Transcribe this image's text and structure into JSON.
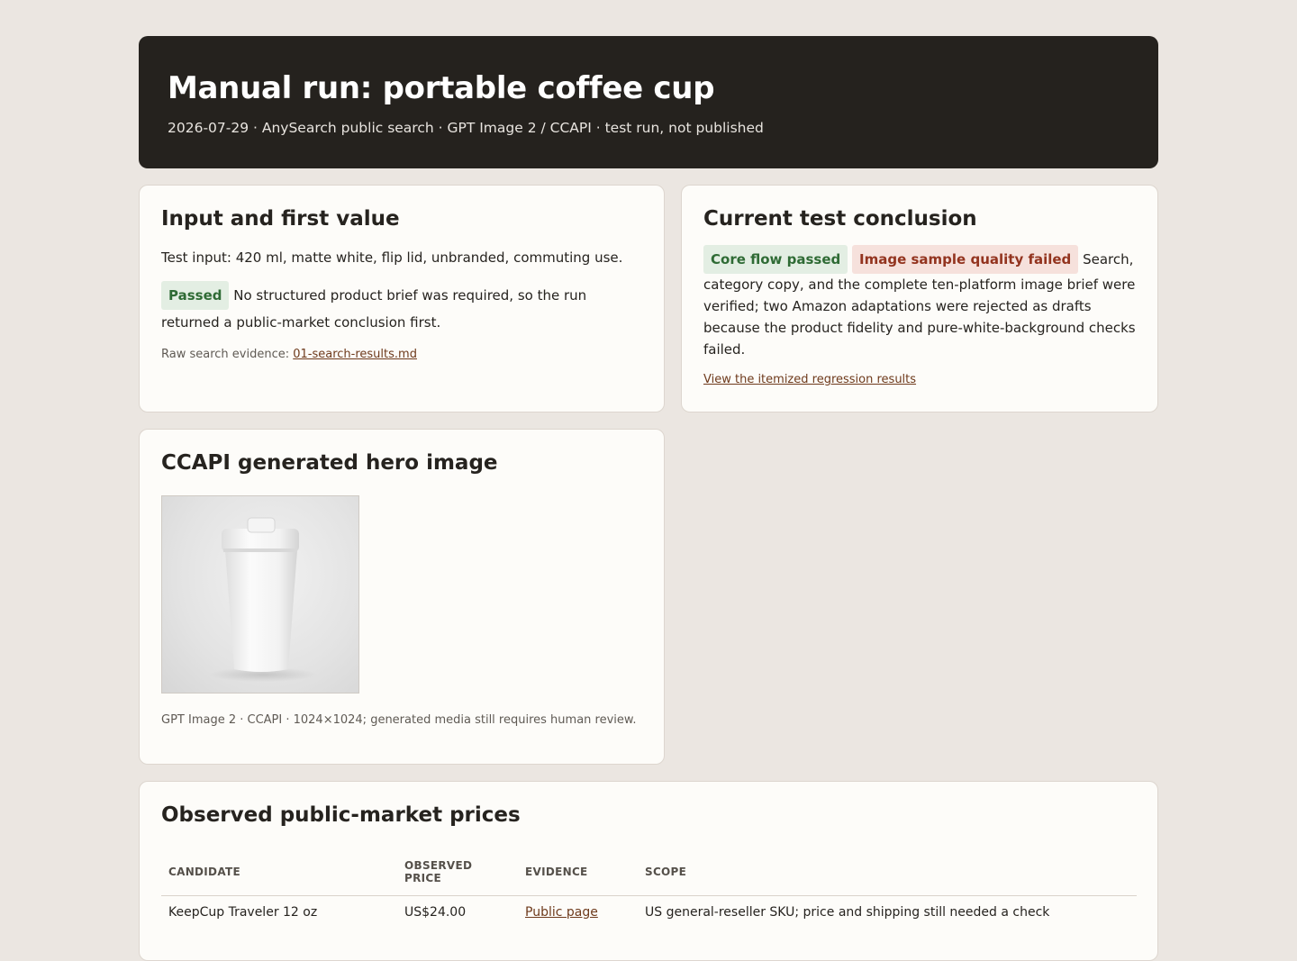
{
  "header": {
    "title": "Manual run: portable coffee cup",
    "meta": "2026-07-29 · AnySearch public search · GPT Image 2 / CCAPI · test run, not published"
  },
  "input_card": {
    "title": "Input and first value",
    "test_input": "Test input: 420 ml, matte white, flip lid, unbranded, commuting use.",
    "badge": "Passed",
    "result_text": "No structured product brief was required, so the run returned a public-market conclusion first.",
    "evidence_label": "Raw search evidence: ",
    "evidence_link": "01-search-results.md"
  },
  "conclusion_card": {
    "title": "Current test conclusion",
    "badge_pass": "Core flow passed",
    "badge_fail": "Image sample quality failed",
    "text": "Search, category copy, and the complete ten-platform image brief were verified; two Amazon adaptations were rejected as drafts because the product fidelity and pure-white-background checks failed.",
    "link": "View the itemized regression results"
  },
  "hero_card": {
    "title": "CCAPI generated hero image",
    "caption": "GPT Image 2 · CCAPI · 1024×1024; generated media still requires human review."
  },
  "prices_card": {
    "title": "Observed public-market prices",
    "columns": [
      "CANDIDATE",
      "OBSERVED PRICE",
      "EVIDENCE",
      "SCOPE"
    ],
    "rows": [
      {
        "candidate": "KeepCup Traveler 12 oz",
        "price": "US$24.00",
        "evidence": "Public page",
        "scope": "US general-reseller SKU; price and shipping still needed a check"
      }
    ]
  },
  "colors": {
    "page_bg": "#ebe6e1",
    "hero_bg": "#25221e",
    "card_bg": "#fdfcf9",
    "pass_bg": "#e3eee3",
    "pass_text": "#2f6b35",
    "fail_bg": "#f6e1dc",
    "fail_text": "#93341f",
    "link": "#6e3a1c"
  }
}
